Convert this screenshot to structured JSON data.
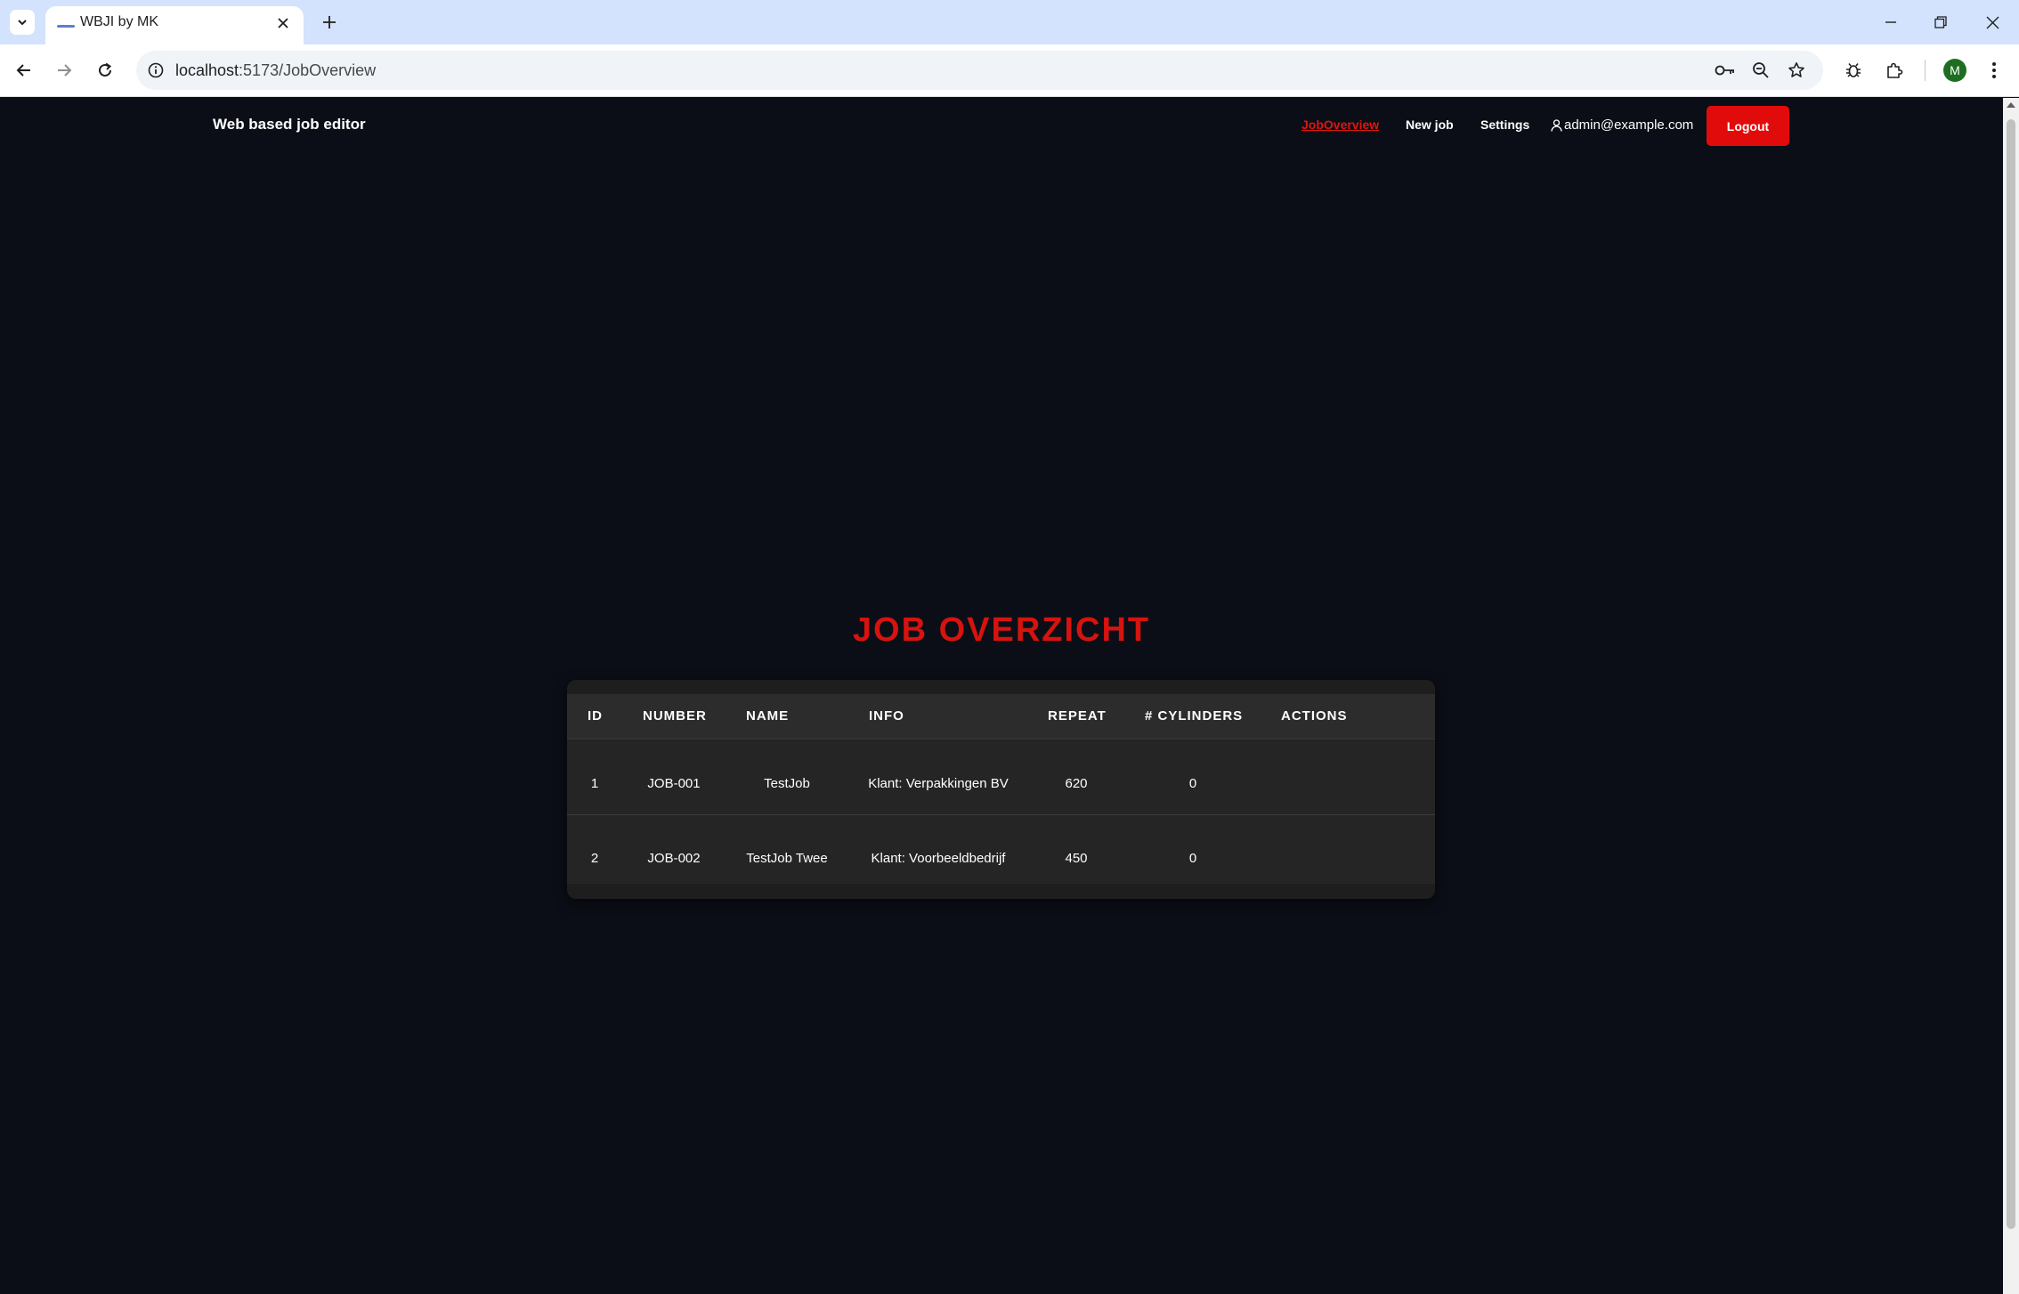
{
  "browser": {
    "tab_title": "WBJI by MK",
    "url_host": "localhost",
    "url_path": ":5173/JobOverview",
    "profile_initial": "M"
  },
  "app": {
    "brand": "Web based job editor",
    "nav": {
      "job_overview": "JobOverview",
      "new_job": "New job",
      "settings": "Settings"
    },
    "user_email": "admin@example.com",
    "logout_label": "Logout"
  },
  "main": {
    "heading": "JOB OVERZICHT",
    "table": {
      "headers": {
        "id": "ID",
        "number": "NUMBER",
        "name": "NAME",
        "info": "INFO",
        "repeat": "REPEAT",
        "cylinders": "# CYLINDERS",
        "actions": "ACTIONS"
      },
      "rows": [
        {
          "id": "1",
          "number": "JOB-001",
          "name": "TestJob",
          "info": "Klant: Verpakkingen BV",
          "repeat": "620",
          "cylinders": "0"
        },
        {
          "id": "2",
          "number": "JOB-002",
          "name": "TestJob Twee",
          "info": "Klant: Voorbeeldbedrijf",
          "repeat": "450",
          "cylinders": "0"
        }
      ]
    }
  },
  "colors": {
    "page_background": "#0b0e16",
    "accent_red": "#e20b0b",
    "heading_red": "#d6130f",
    "table_background": "#252525",
    "table_header_background": "#2c2c2c"
  },
  "icons": {
    "tab_search": "chevron-down-icon",
    "tab_close": "close-icon",
    "new_tab": "plus-icon",
    "minimize": "minimize-icon",
    "restore": "restore-icon",
    "close_window": "close-icon",
    "back": "arrow-left-icon",
    "forward": "arrow-right-icon",
    "reload": "reload-icon",
    "site_info": "info-icon",
    "password": "key-icon",
    "zoom": "zoom-icon",
    "bookmark": "star-icon",
    "bug": "bug-icon",
    "extensions": "puzzle-icon",
    "menu": "kebab-menu-icon",
    "user": "user-icon"
  }
}
